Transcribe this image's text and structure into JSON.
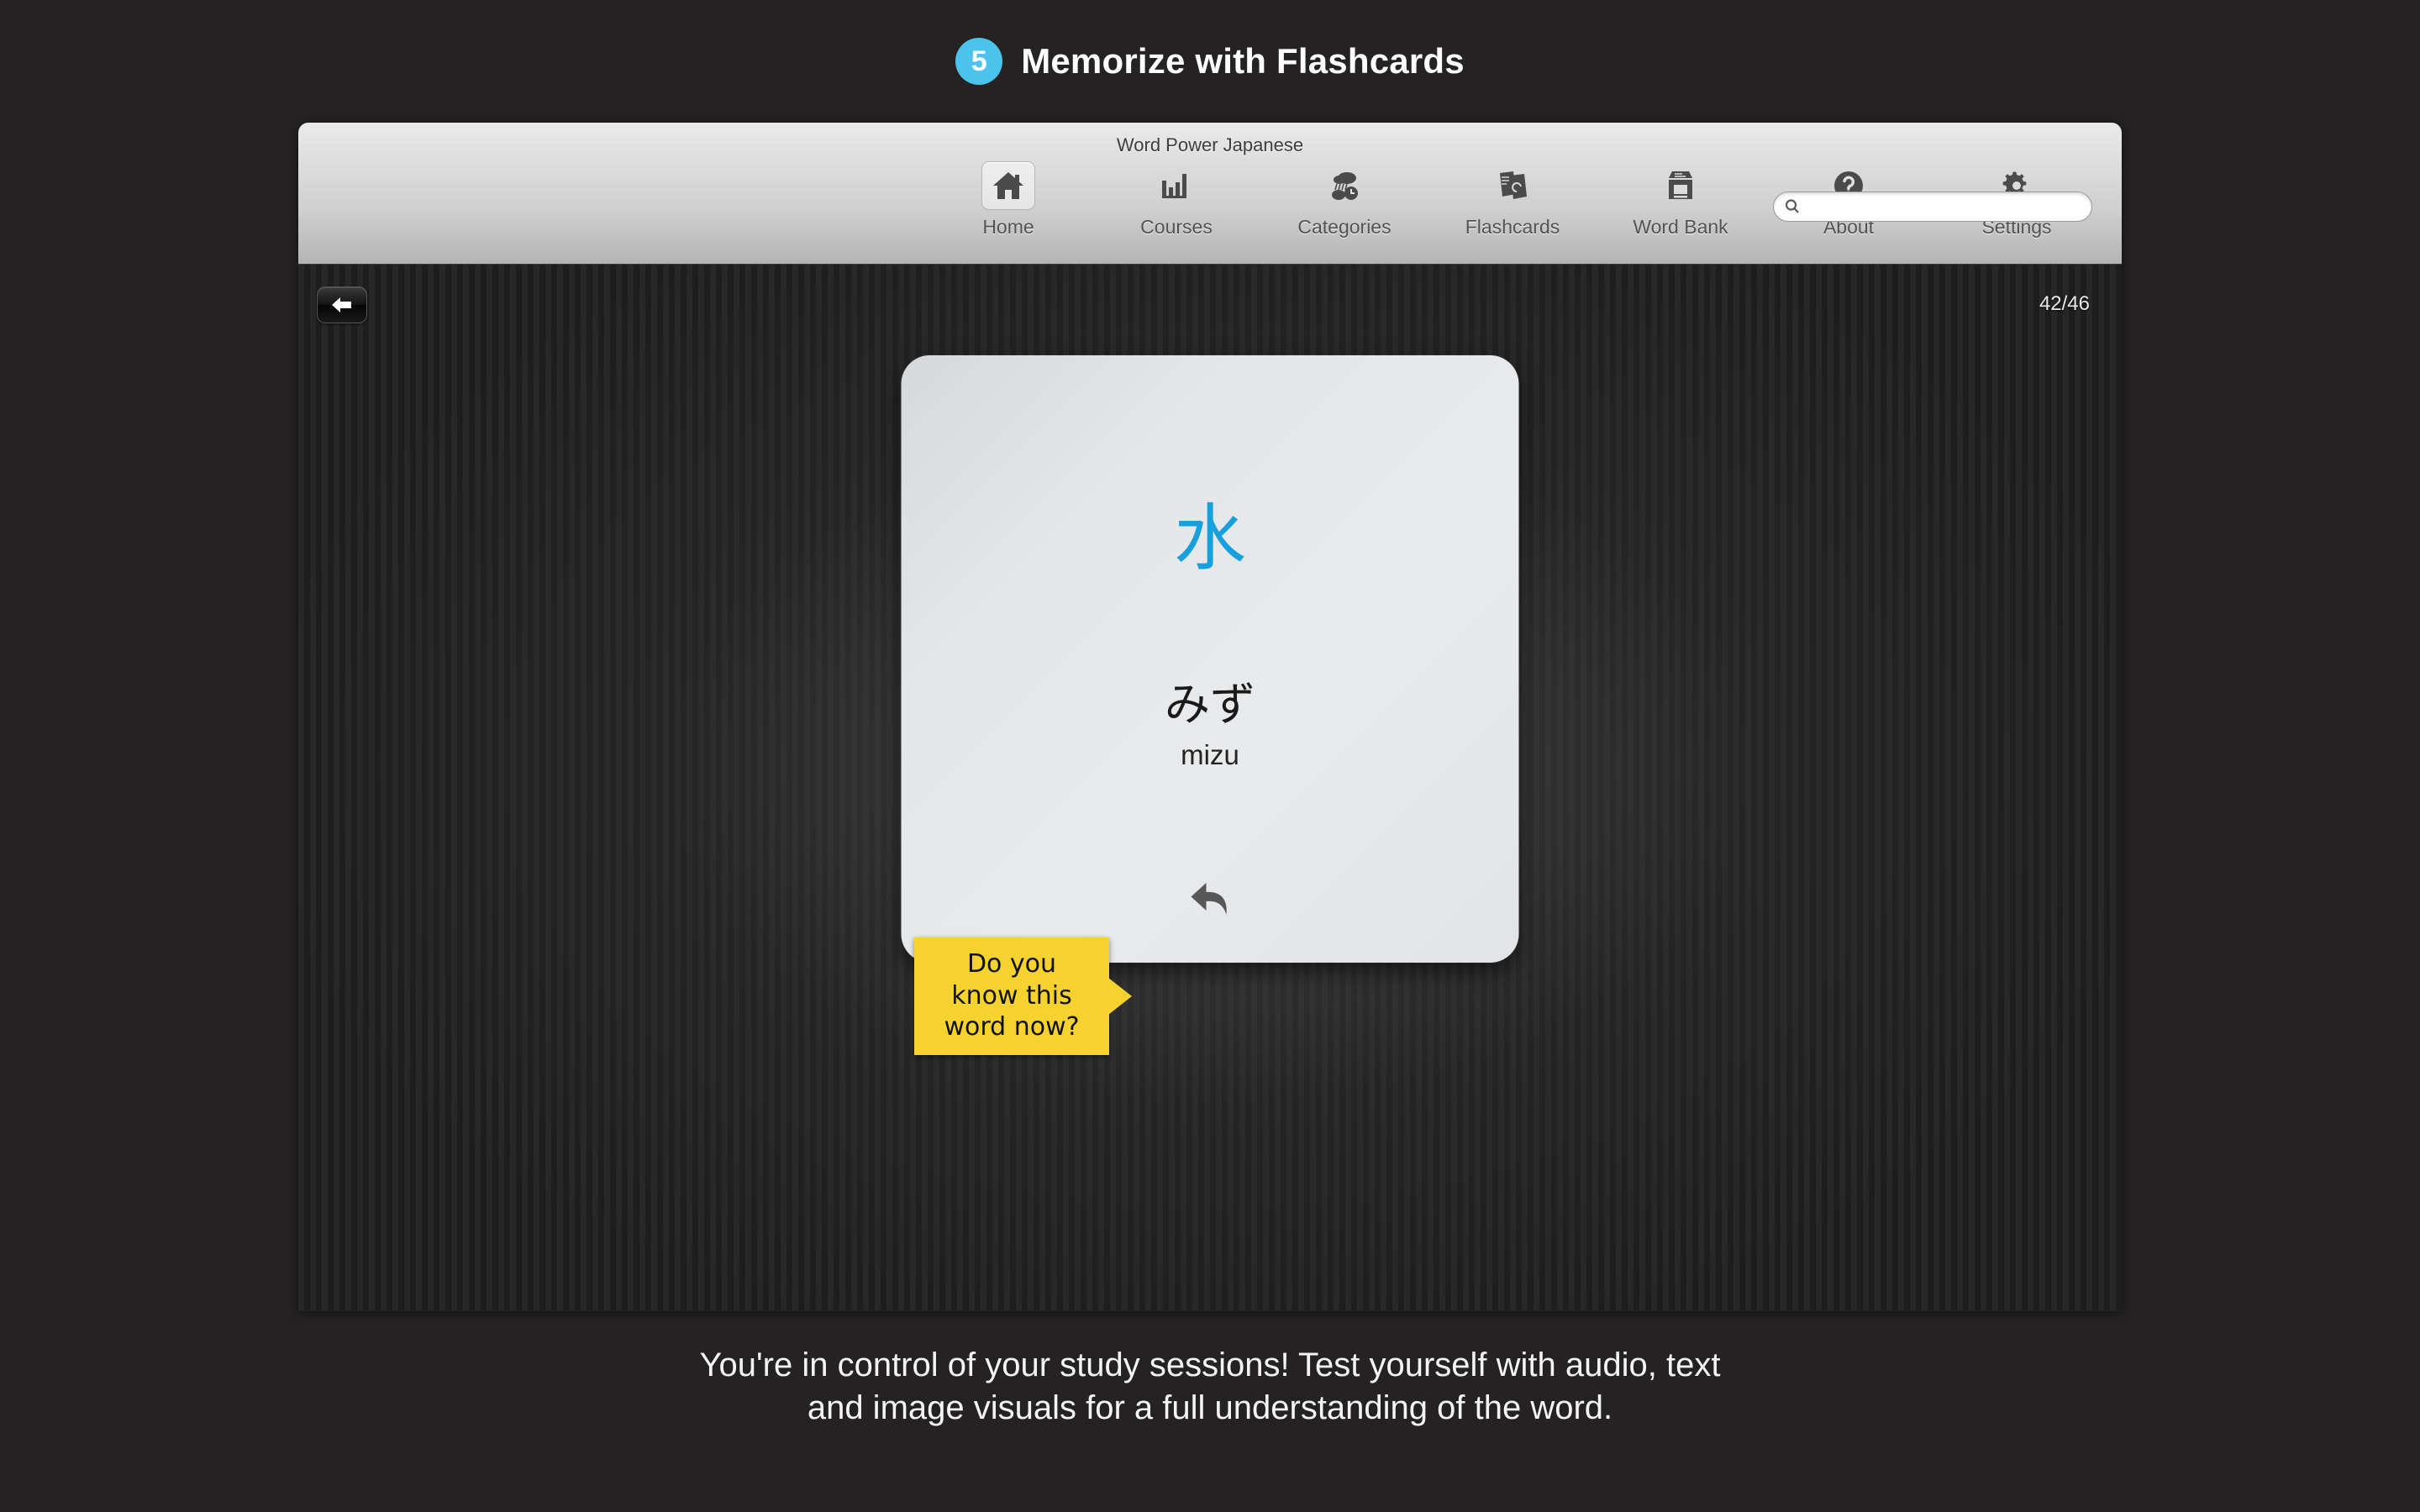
{
  "header": {
    "step_number": "5",
    "title": "Memorize with Flashcards",
    "badge_color": "#4cc3ec"
  },
  "app_window": {
    "title": "Word Power Japanese",
    "toolbar": {
      "items": [
        {
          "label": "Home",
          "icon": "home-icon",
          "active": true
        },
        {
          "label": "Courses",
          "icon": "bar-chart-icon",
          "active": false
        },
        {
          "label": "Categories",
          "icon": "categories-icon",
          "active": false
        },
        {
          "label": "Flashcards",
          "icon": "flashcards-icon",
          "active": false
        },
        {
          "label": "Word Bank",
          "icon": "word-bank-icon",
          "active": false
        },
        {
          "label": "About",
          "icon": "question-mark-icon",
          "active": false
        },
        {
          "label": "Settings",
          "icon": "gear-icon",
          "active": false
        }
      ],
      "search": {
        "icon": "search-icon",
        "value": "",
        "placeholder": ""
      }
    },
    "content": {
      "back_button_icon": "back-arrow-icon",
      "counter": "42/46",
      "flashcard": {
        "kanji": "水",
        "kana": "みず",
        "romaji": "mizu",
        "flip_icon": "flip-card-icon",
        "kanji_color": "#17a0dd"
      },
      "callout": {
        "lines": [
          "Do you",
          "know this",
          "word now?"
        ],
        "background_color": "#f5d22e",
        "text_color": "#111111"
      }
    }
  },
  "caption": {
    "line1": "You're in control of your study sessions! Test yourself with audio, text",
    "line2": "and image visuals for a full understanding of the word."
  }
}
